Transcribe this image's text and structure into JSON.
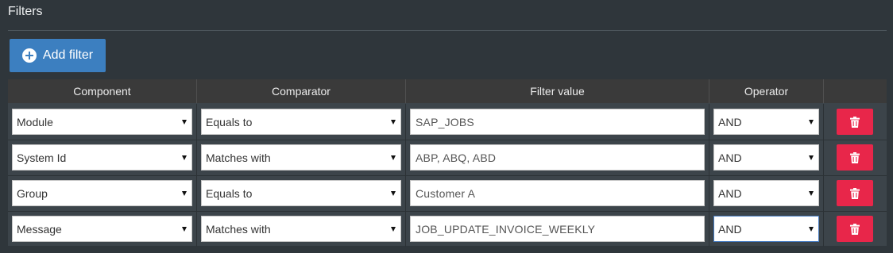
{
  "panel": {
    "title": "Filters"
  },
  "toolbar": {
    "add_filter_label": "Add filter"
  },
  "table": {
    "headers": [
      "Component",
      "Comparator",
      "Filter value",
      "Operator",
      ""
    ],
    "rows": [
      {
        "component": "Module",
        "comparator": "Equals to",
        "value": "SAP_JOBS",
        "operator": "AND"
      },
      {
        "component": "System Id",
        "comparator": "Matches with",
        "value": "ABP, ABQ, ABD",
        "operator": "AND"
      },
      {
        "component": "Group",
        "comparator": "Equals to",
        "value": "Customer A",
        "operator": "AND"
      },
      {
        "component": "Message",
        "comparator": "Matches with",
        "value": "JOB_UPDATE_INVOICE_WEEKLY",
        "operator": "AND"
      }
    ]
  },
  "icons": {
    "add": "plus-circle-icon",
    "delete": "trash-icon",
    "dropdown": "caret-down-icon"
  },
  "colors": {
    "add_button": "#3c7fc0",
    "delete_button": "#e8264a",
    "background": "#2f363b"
  }
}
